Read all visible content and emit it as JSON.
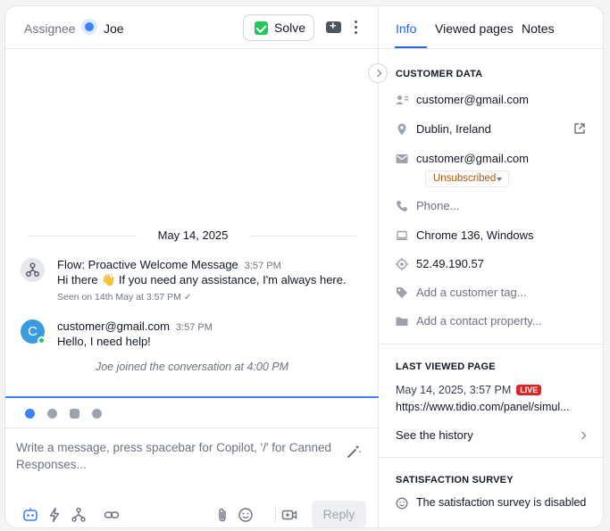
{
  "header": {
    "assignee_label": "Assignee",
    "assignee_name": "Joe",
    "solve_label": "Solve"
  },
  "conversation": {
    "date": "May 14, 2025",
    "messages": [
      {
        "sender": "Flow: Proactive Welcome Message",
        "time": "3:57 PM",
        "text": "Hi there 👋 If you need any assistance, I'm always here.",
        "seen": "Seen on 14th May at 3:57 PM ✓"
      },
      {
        "sender": "customer@gmail.com",
        "avatar_letter": "C",
        "time": "3:57 PM",
        "text": "Hello, I need help!"
      }
    ],
    "system_note": "Joe joined the conversation at 4:00 PM"
  },
  "composer": {
    "placeholder": "Write a message, press spacebar for Copilot, '/' for Canned Responses...",
    "reply_label": "Reply",
    "channels": [
      "tidio-chat-icon",
      "messenger-icon",
      "instagram-icon",
      "whatsapp-icon"
    ]
  },
  "sidebar": {
    "tabs": [
      "Info",
      "Viewed pages",
      "Notes"
    ],
    "customer_data": {
      "title": "CUSTOMER DATA",
      "name": "customer@gmail.com",
      "location": "Dublin, Ireland",
      "email": "customer@gmail.com",
      "subscription": "Unsubscribed",
      "phone_placeholder": "Phone...",
      "browser": "Chrome 136, Windows",
      "ip": "52.49.190.57",
      "add_tag": "Add a customer tag...",
      "add_property": "Add a contact property..."
    },
    "last_viewed": {
      "title": "LAST VIEWED PAGE",
      "datetime": "May 14, 2025, 3:57 PM",
      "live_badge": "LIVE",
      "url": "https://www.tidio.com/panel/simul...",
      "history_label": "See the history"
    },
    "survey": {
      "title": "SATISFACTION SURVEY",
      "status": "The satisfaction survey is disabled"
    }
  },
  "colors": {
    "accent": "#2563eb",
    "success": "#22c55e",
    "live": "#dc2626",
    "unsubscribed": "#b45309"
  }
}
